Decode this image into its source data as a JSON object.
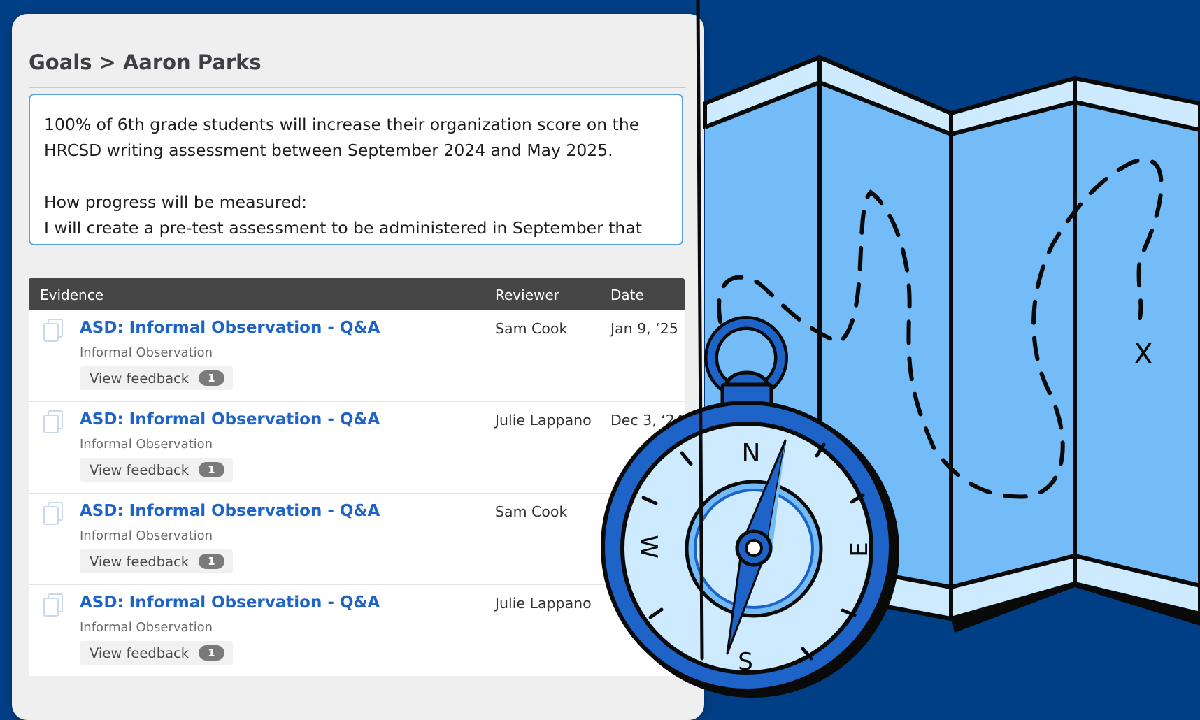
{
  "breadcrumb": {
    "section": "Goals",
    "separator": ">",
    "person": "Aaron Parks"
  },
  "goal": {
    "statement": "100% of 6th grade students will increase their organization score on the HRCSD writing assessment between September 2024 and May 2025.",
    "measure_heading": "How progress will be measured:",
    "measure_text": "I will create a pre-test assessment to be administered in September that"
  },
  "table": {
    "headers": {
      "evidence": "Evidence",
      "reviewer": "Reviewer",
      "date": "Date"
    },
    "rows": [
      {
        "title": "ASD: Informal Observation - Q&A",
        "type": "Informal Observation",
        "feedback_label": "View feedback",
        "feedback_count": "1",
        "reviewer": "Sam Cook",
        "date": "Jan 9, ‘25"
      },
      {
        "title": "ASD: Informal Observation - Q&A",
        "type": "Informal Observation",
        "feedback_label": "View feedback",
        "feedback_count": "1",
        "reviewer": "Julie Lappano",
        "date": "Dec 3, ‘24"
      },
      {
        "title": "ASD: Informal Observation - Q&A",
        "type": "Informal Observation",
        "feedback_label": "View feedback",
        "feedback_count": "1",
        "reviewer": "Sam Cook",
        "date": ""
      },
      {
        "title": "ASD: Informal Observation - Q&A",
        "type": "Informal Observation",
        "feedback_label": "View feedback",
        "feedback_count": "1",
        "reviewer": "Julie Lappano",
        "date": ""
      }
    ]
  },
  "illustration": {
    "compass_letters": {
      "n": "N",
      "e": "E",
      "s": "S",
      "w": "W"
    },
    "map_mark": "X"
  },
  "colors": {
    "background": "#003e85",
    "link": "#1e63c8",
    "map_panel": "#74bcf7",
    "compass_ring": "#1e63c8"
  },
  "icons": [
    "document-copy-icon",
    "compass-icon",
    "treasure-map-icon"
  ]
}
